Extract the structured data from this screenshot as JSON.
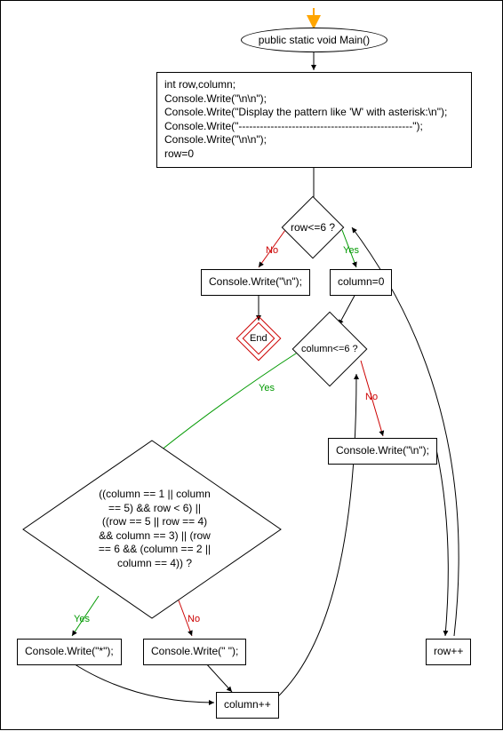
{
  "start_arrow_color": "#ffa500",
  "entry": {
    "label": "public static void Main()"
  },
  "init_block": {
    "lines": [
      "int row,column;",
      "Console.Write(\"\\n\\n\");",
      "Console.Write(\"Display the pattern like 'W' with asterisk:\\n\");",
      "Console.Write(\"-------------------------------------------------\");",
      "Console.Write(\"\\n\\n\");",
      "row=0"
    ]
  },
  "cond_row": {
    "text": "row<=6 ?",
    "yes": "Yes",
    "no": "No"
  },
  "stmt_col_init": {
    "text": "column=0"
  },
  "stmt_write_nl_left": {
    "text": "Console.Write(\"\\n\");"
  },
  "end": {
    "text": "End"
  },
  "cond_col": {
    "text": "column<=6 ?",
    "yes": "Yes",
    "no": "No"
  },
  "stmt_write_nl_right": {
    "text": "Console.Write(\"\\n\");"
  },
  "stmt_row_inc": {
    "text": "row++"
  },
  "cond_big": {
    "lines": [
      "((column == 1 || column",
      "== 5) && row < 6) ||",
      "((row == 5 || row == 4)",
      "&& column == 3) || (row",
      "== 6 && (column == 2 ||",
      "column == 4)) ?"
    ],
    "yes": "Yes",
    "no": "No"
  },
  "stmt_write_star": {
    "text": "Console.Write(\"*\");"
  },
  "stmt_write_space": {
    "text": "Console.Write(\" \");"
  },
  "stmt_col_inc": {
    "text": "column++"
  }
}
